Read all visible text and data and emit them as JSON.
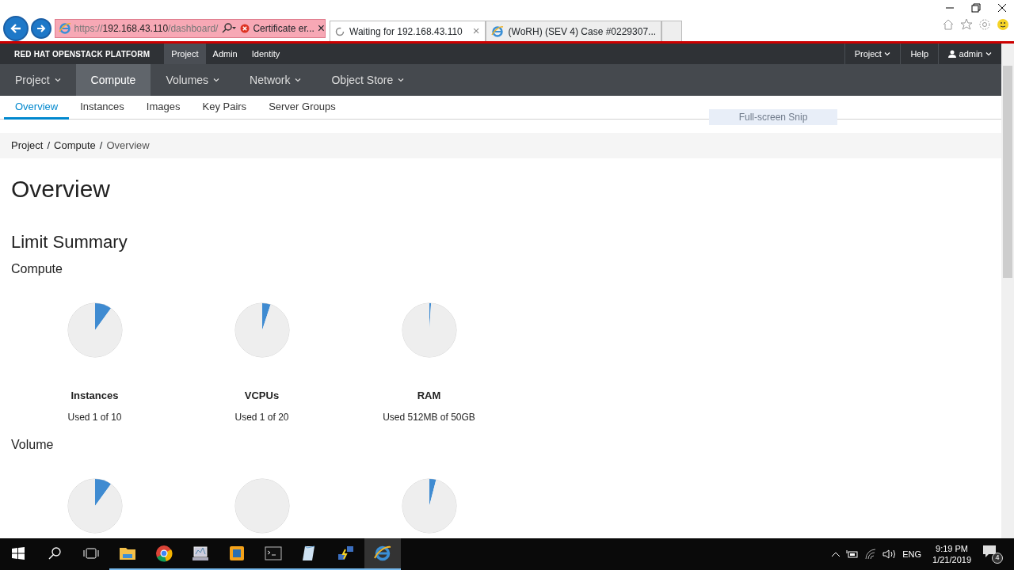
{
  "browser": {
    "address": {
      "scheme": "https://",
      "host": "192.168.43.110",
      "path": "/dashboard/",
      "certificate": "Certificate er...",
      "close": "×"
    },
    "tabs": [
      {
        "title": "Waiting for 192.168.43.110",
        "selected": true,
        "kind": "loading",
        "close": "×"
      },
      {
        "title": "(WoRH) (SEV 4) Case #0229307...",
        "selected": false,
        "kind": "ie"
      }
    ]
  },
  "topbar": {
    "brand": "RED HAT OPENSTACK PLATFORM",
    "items": [
      {
        "label": "Project",
        "selected": true
      },
      {
        "label": "Admin",
        "selected": false
      },
      {
        "label": "Identity",
        "selected": false
      }
    ],
    "right": [
      {
        "label": "Project",
        "kind": "dropdown"
      },
      {
        "label": "Help",
        "kind": "link"
      },
      {
        "label": "admin",
        "kind": "user"
      }
    ]
  },
  "mainnav": [
    {
      "label": "Project",
      "selected": false,
      "dropdown": true
    },
    {
      "label": "Compute",
      "selected": true,
      "dropdown": false
    },
    {
      "label": "Volumes",
      "selected": false,
      "dropdown": true
    },
    {
      "label": "Network",
      "selected": false,
      "dropdown": true
    },
    {
      "label": "Object Store",
      "selected": false,
      "dropdown": true
    }
  ],
  "subnav": [
    {
      "label": "Overview",
      "selected": true
    },
    {
      "label": "Instances",
      "selected": false
    },
    {
      "label": "Images",
      "selected": false
    },
    {
      "label": "Key Pairs",
      "selected": false
    },
    {
      "label": "Server Groups",
      "selected": false
    }
  ],
  "tooltip": "Full-screen Snip",
  "breadcrumb": {
    "separator": "/",
    "items": [
      "Project",
      "Compute",
      "Overview"
    ]
  },
  "title": "Overview",
  "subtitle": "Limit Summary",
  "sections": [
    {
      "title": "Compute",
      "charts": [
        {
          "name": "Instances",
          "used": "Used 1 of 10",
          "chart_data": {
            "type": "pie",
            "values": [
              10,
              90
            ]
          }
        },
        {
          "name": "VCPUs",
          "used": "Used 1 of 20",
          "chart_data": {
            "type": "pie",
            "values": [
              5,
              95
            ]
          }
        },
        {
          "name": "RAM",
          "used": "Used 512MB of 50GB",
          "chart_data": {
            "type": "pie",
            "values": [
              1,
              99
            ]
          }
        }
      ]
    },
    {
      "title": "Volume",
      "charts": [
        {
          "chart_data": {
            "type": "pie",
            "values": [
              10,
              90
            ]
          }
        },
        {
          "chart_data": {
            "type": "pie",
            "values": [
              0,
              100
            ]
          }
        },
        {
          "chart_data": {
            "type": "pie",
            "values": [
              4,
              96
            ]
          }
        }
      ]
    }
  ],
  "taskbar": {
    "apps": [
      {
        "kind": "folder",
        "selected": false
      },
      {
        "kind": "chrome",
        "selected": false
      },
      {
        "kind": "monitor",
        "selected": false
      },
      {
        "kind": "vmware",
        "selected": false
      },
      {
        "kind": "terminal",
        "selected": false
      },
      {
        "kind": "notepad",
        "selected": false
      },
      {
        "kind": "network",
        "selected": false
      },
      {
        "kind": "ie",
        "selected": true
      }
    ],
    "language": "ENG",
    "time": "9:19 PM",
    "date": "1/21/2019",
    "notifications": "4"
  }
}
